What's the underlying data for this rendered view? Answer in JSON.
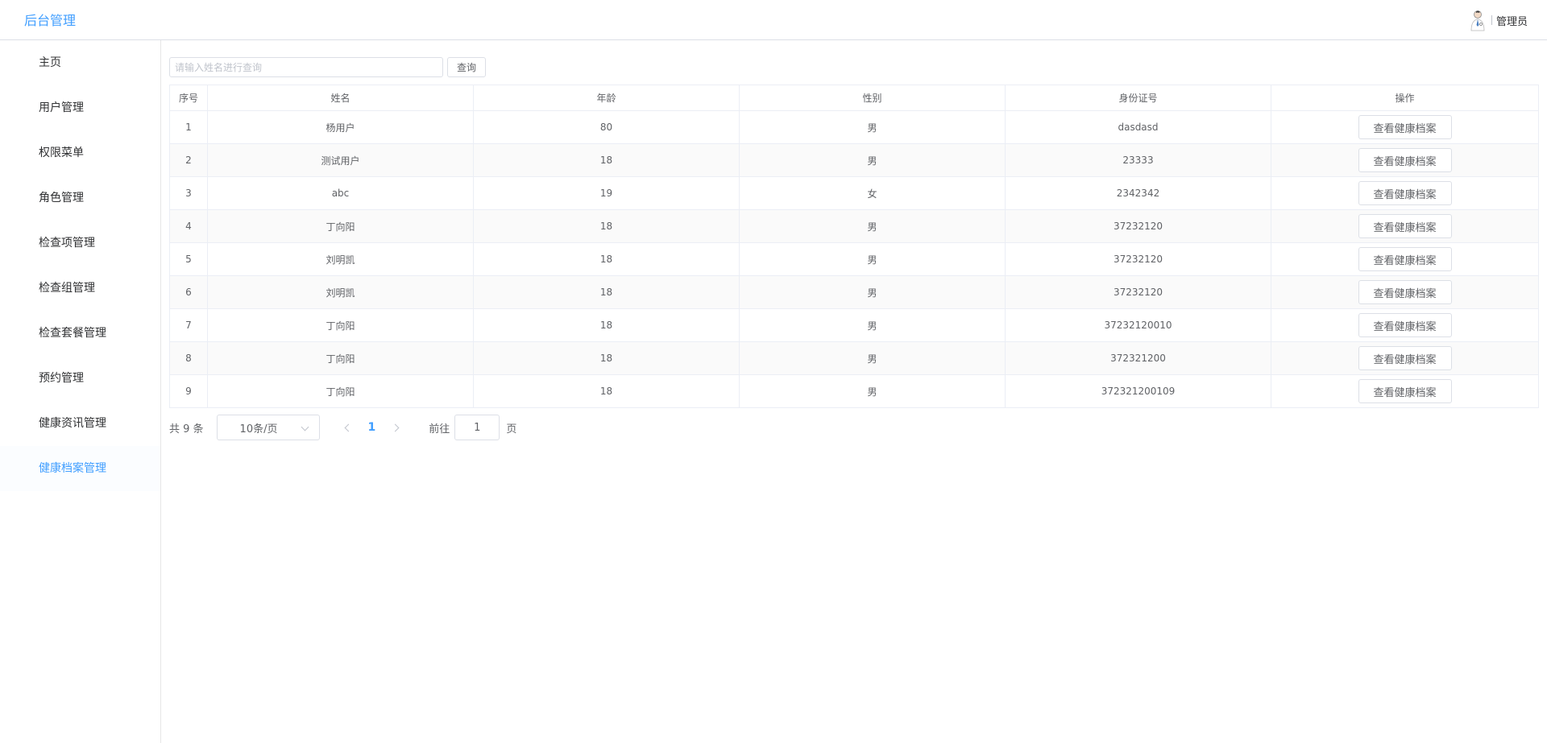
{
  "header": {
    "brand": "后台管理",
    "user_name": "管理员"
  },
  "sidebar": {
    "items": [
      {
        "label": "主页"
      },
      {
        "label": "用户管理"
      },
      {
        "label": "权限菜单"
      },
      {
        "label": "角色管理"
      },
      {
        "label": "检查项管理"
      },
      {
        "label": "检查组管理"
      },
      {
        "label": "检查套餐管理"
      },
      {
        "label": "预约管理"
      },
      {
        "label": "健康资讯管理"
      },
      {
        "label": "健康档案管理"
      }
    ],
    "active_index": 9
  },
  "search": {
    "placeholder": "请输入姓名进行查询",
    "button_label": "查询"
  },
  "table": {
    "columns": [
      "序号",
      "姓名",
      "年龄",
      "性别",
      "身份证号",
      "操作"
    ],
    "action_label": "查看健康档案",
    "rows": [
      {
        "index": "1",
        "name": "杨用户",
        "age": "80",
        "gender": "男",
        "id_number": "dasdasd"
      },
      {
        "index": "2",
        "name": "测试用户",
        "age": "18",
        "gender": "男",
        "id_number": "23333"
      },
      {
        "index": "3",
        "name": "abc",
        "age": "19",
        "gender": "女",
        "id_number": "2342342"
      },
      {
        "index": "4",
        "name": "丁向阳",
        "age": "18",
        "gender": "男",
        "id_number": "37232120"
      },
      {
        "index": "5",
        "name": "刘明凯",
        "age": "18",
        "gender": "男",
        "id_number": "37232120"
      },
      {
        "index": "6",
        "name": "刘明凯",
        "age": "18",
        "gender": "男",
        "id_number": "37232120"
      },
      {
        "index": "7",
        "name": "丁向阳",
        "age": "18",
        "gender": "男",
        "id_number": "37232120010"
      },
      {
        "index": "8",
        "name": "丁向阳",
        "age": "18",
        "gender": "男",
        "id_number": "372321200"
      },
      {
        "index": "9",
        "name": "丁向阳",
        "age": "18",
        "gender": "男",
        "id_number": "372321200109"
      }
    ]
  },
  "pagination": {
    "total_text": "共 9 条",
    "page_size": "10条/页",
    "current_page": "1",
    "goto_label": "前往",
    "goto_value": "1",
    "goto_suffix": "页"
  },
  "colors": {
    "accent": "#409eff",
    "border": "#dcdfe6",
    "text": "#606266"
  }
}
